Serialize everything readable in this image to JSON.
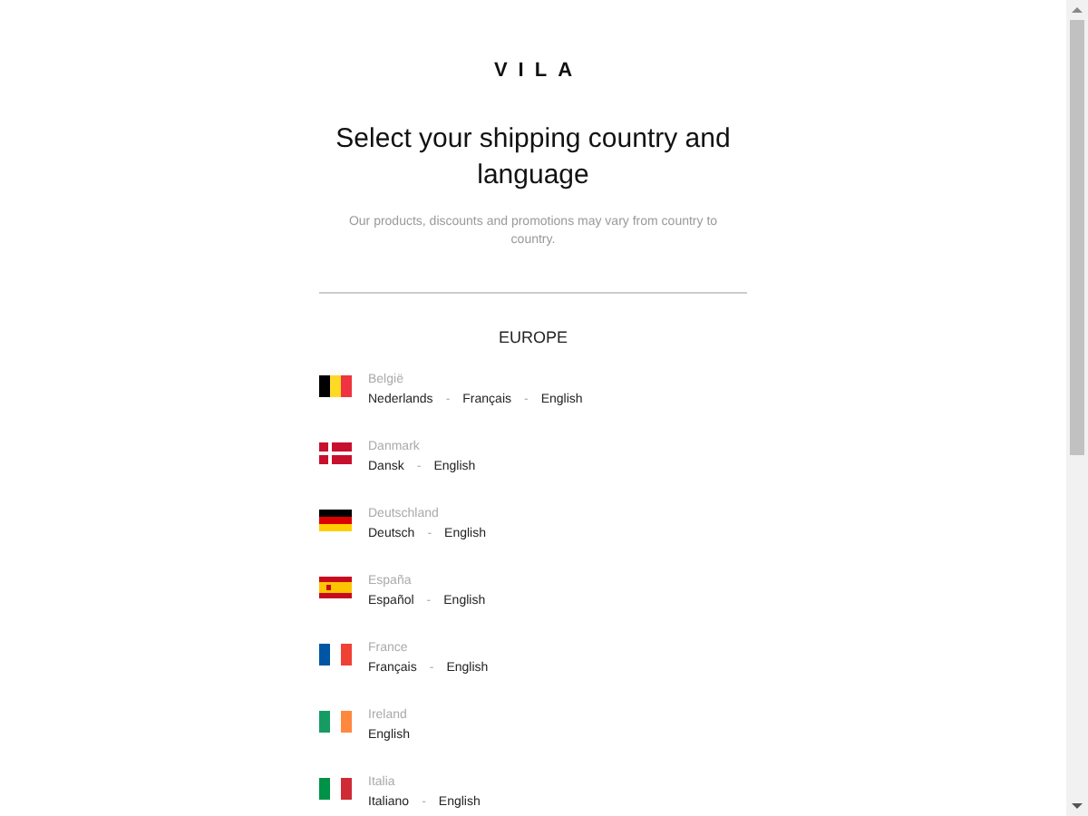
{
  "logo": "VILA",
  "title": "Select your shipping country and language",
  "subtitle": "Our products, discounts and promotions may vary from country to country.",
  "region": "EUROPE",
  "countries": [
    {
      "name": "België",
      "kind": "belgium",
      "items": [
        {
          "kind": "language",
          "text": "Nederlands"
        },
        {
          "kind": "separator",
          "text": "-"
        },
        {
          "kind": "language",
          "text": "Français"
        },
        {
          "kind": "separator",
          "text": "-"
        },
        {
          "kind": "language",
          "text": "English"
        }
      ]
    },
    {
      "name": "Danmark",
      "kind": "denmark",
      "items": [
        {
          "kind": "language",
          "text": "Dansk"
        },
        {
          "kind": "separator",
          "text": "-"
        },
        {
          "kind": "language",
          "text": "English"
        }
      ]
    },
    {
      "name": "Deutschland",
      "kind": "germany",
      "items": [
        {
          "kind": "language",
          "text": "Deutsch"
        },
        {
          "kind": "separator",
          "text": "-"
        },
        {
          "kind": "language",
          "text": "English"
        }
      ]
    },
    {
      "name": "España",
      "kind": "spain",
      "items": [
        {
          "kind": "language",
          "text": "Español"
        },
        {
          "kind": "separator",
          "text": "-"
        },
        {
          "kind": "language",
          "text": "English"
        }
      ]
    },
    {
      "name": "France",
      "kind": "france",
      "items": [
        {
          "kind": "language",
          "text": "Français"
        },
        {
          "kind": "separator",
          "text": "-"
        },
        {
          "kind": "language",
          "text": "English"
        }
      ]
    },
    {
      "name": "Ireland",
      "kind": "ireland",
      "items": [
        {
          "kind": "language",
          "text": "English"
        }
      ]
    },
    {
      "name": "Italia",
      "kind": "italy",
      "items": [
        {
          "kind": "language",
          "text": "Italiano"
        },
        {
          "kind": "separator",
          "text": "-"
        },
        {
          "kind": "language",
          "text": "English"
        }
      ]
    }
  ]
}
